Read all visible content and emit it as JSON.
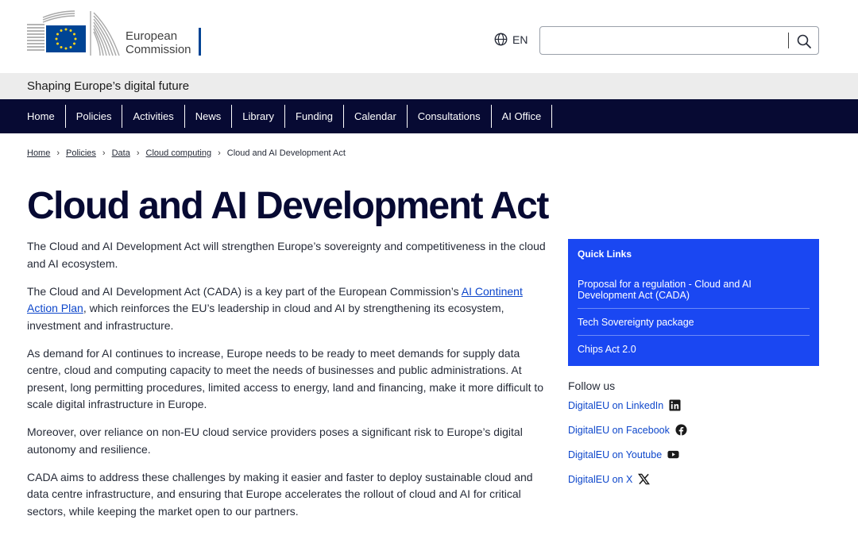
{
  "header": {
    "logo_line1": "European",
    "logo_line2": "Commission",
    "language": "EN",
    "search_placeholder": ""
  },
  "site_bar": {
    "name": "Shaping Europe’s digital future"
  },
  "nav": {
    "items": [
      "Home",
      "Policies",
      "Activities",
      "News",
      "Library",
      "Funding",
      "Calendar",
      "Consultations",
      "AI Office"
    ]
  },
  "breadcrumb": {
    "items": [
      "Home",
      "Policies",
      "Data",
      "Cloud computing"
    ],
    "current": "Cloud and AI Development Act"
  },
  "page": {
    "title": "Cloud and AI Development Act",
    "p1": "The Cloud and AI Development Act will strengthen Europe’s sovereignty and competitiveness in the cloud and AI ecosystem.",
    "p2_before": "The Cloud and AI Development Act (CADA) is a key part of the European Commission’s ",
    "p2_link": "AI Continent Action Plan",
    "p2_after": ", which reinforces the EU’s leadership in cloud and AI by strengthening its ecosystem, investment and infrastructure.",
    "p3": "As demand for AI continues to increase, Europe needs to be ready to meet demands for supply data centre, cloud and computing capacity to meet the needs of businesses and public administrations. At present, long permitting procedures, limited access to energy, land and financing, make it more difficult to scale digital infrastructure in Europe.",
    "p4": "Moreover, over reliance on non-EU cloud service providers poses a significant risk to Europe’s digital autonomy and resilience.",
    "p5": "CADA aims to address these challenges by making it easier and faster to deploy sustainable cloud and data centre infrastructure, and ensuring that Europe accelerates the rollout of cloud and AI for critical sectors, while keeping the market open to our partners."
  },
  "quick_links": {
    "title": "Quick Links",
    "items": [
      "Proposal for a regulation - Cloud and AI Development Act (CADA)",
      "Tech Sovereignty package",
      "Chips Act 2.0"
    ]
  },
  "follow": {
    "title": "Follow us",
    "items": [
      {
        "label": "DigitalEU on LinkedIn",
        "icon": "linkedin-icon"
      },
      {
        "label": "DigitalEU on Facebook",
        "icon": "facebook-icon"
      },
      {
        "label": "DigitalEU on Youtube",
        "icon": "youtube-icon"
      },
      {
        "label": "DigitalEU on X",
        "icon": "x-icon"
      }
    ]
  },
  "colors": {
    "nav_bg": "#070a33",
    "quick_links_bg": "#1a47f2",
    "link": "#0e47cb",
    "eu_blue": "#004494",
    "eu_yellow": "#ffd617"
  }
}
